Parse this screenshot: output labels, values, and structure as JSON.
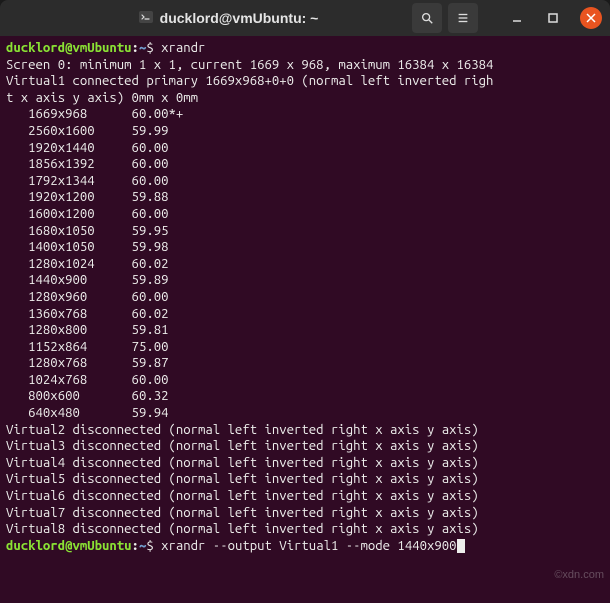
{
  "titlebar": {
    "title": "ducklord@vmUbuntu: ~",
    "search_label": "Search",
    "menu_label": "Menu",
    "minimize_label": "Minimize",
    "maximize_label": "Maximize",
    "close_label": "Close"
  },
  "prompt": {
    "user_host": "ducklord@vmUbuntu",
    "colon": ":",
    "path": "~",
    "dollar": "$"
  },
  "commands": {
    "first": "xrandr",
    "second": "xrandr --output Virtual1 --mode 1440x900"
  },
  "screen_line": "Screen 0: minimum 1 x 1, current 1669 x 968, maximum 16384 x 16384",
  "virtual1_line1": "Virtual1 connected primary 1669x968+0+0 (normal left inverted righ",
  "virtual1_line2": "t x axis y axis) 0mm x 0mm",
  "modes": [
    {
      "res": "   1669x968  ",
      "rate": "    60.00*+"
    },
    {
      "res": "   2560x1600 ",
      "rate": "    59.99"
    },
    {
      "res": "   1920x1440 ",
      "rate": "    60.00"
    },
    {
      "res": "   1856x1392 ",
      "rate": "    60.00"
    },
    {
      "res": "   1792x1344 ",
      "rate": "    60.00"
    },
    {
      "res": "   1920x1200 ",
      "rate": "    59.88"
    },
    {
      "res": "   1600x1200 ",
      "rate": "    60.00"
    },
    {
      "res": "   1680x1050 ",
      "rate": "    59.95"
    },
    {
      "res": "   1400x1050 ",
      "rate": "    59.98"
    },
    {
      "res": "   1280x1024 ",
      "rate": "    60.02"
    },
    {
      "res": "   1440x900  ",
      "rate": "    59.89"
    },
    {
      "res": "   1280x960  ",
      "rate": "    60.00"
    },
    {
      "res": "   1360x768  ",
      "rate": "    60.02"
    },
    {
      "res": "   1280x800  ",
      "rate": "    59.81"
    },
    {
      "res": "   1152x864  ",
      "rate": "    75.00"
    },
    {
      "res": "   1280x768  ",
      "rate": "    59.87"
    },
    {
      "res": "   1024x768  ",
      "rate": "    60.00"
    },
    {
      "res": "   800x600   ",
      "rate": "    60.32"
    },
    {
      "res": "   640x480   ",
      "rate": "    59.94"
    }
  ],
  "disconnected": [
    "Virtual2 disconnected (normal left inverted right x axis y axis)",
    "Virtual3 disconnected (normal left inverted right x axis y axis)",
    "Virtual4 disconnected (normal left inverted right x axis y axis)",
    "Virtual5 disconnected (normal left inverted right x axis y axis)",
    "Virtual6 disconnected (normal left inverted right x axis y axis)",
    "Virtual7 disconnected (normal left inverted right x axis y axis)",
    "Virtual8 disconnected (normal left inverted right x axis y axis)"
  ],
  "watermark": "©xdn.com"
}
